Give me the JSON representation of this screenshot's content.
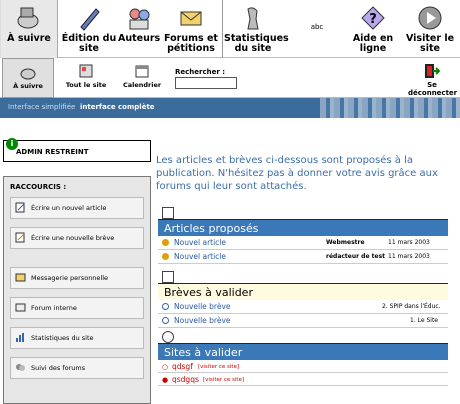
{
  "topnav": [
    {
      "label": "À suivre",
      "icon": "bowl-icon"
    },
    {
      "label": "Édition du site",
      "icon": "pen-icon"
    },
    {
      "label": "Auteurs",
      "icon": "authors-icon"
    },
    {
      "label": "Forums et pétitions",
      "icon": "envelope-icon"
    },
    {
      "label": "Statistiques du site",
      "icon": "sculpture-icon"
    },
    {
      "label": "abc",
      "icon": "language-icon"
    },
    {
      "label": "Aide en ligne",
      "icon": "help-icon"
    },
    {
      "label": "Visiter le site",
      "icon": "play-icon"
    }
  ],
  "subnav": [
    {
      "label": "À suivre"
    },
    {
      "label": "Tout le site"
    },
    {
      "label": "Calendrier"
    }
  ],
  "search": {
    "label": "Rechercher :",
    "value": ""
  },
  "logout": {
    "label": "Se déconnecter"
  },
  "modebar": {
    "simple": "Interface simplifiée",
    "full": "interface complète"
  },
  "aside": {
    "admin": "ADMIN RESTREINT",
    "shortcuts_title": "RACCOURCIS :",
    "shortcuts": [
      "Écrire un nouvel article",
      "Écrire une nouvelle brève",
      "Messagerie personnelle",
      "Forum interne",
      "Statistiques du site",
      "Suivi des forums"
    ]
  },
  "intro": "Les articles et brèves ci-dessous sont proposés à la publication. N'hésitez pas à donner votre avis grâce aux forums qui leur sont attachés.",
  "articles": {
    "title": "Articles proposés",
    "rows": [
      {
        "title": "Nouvel article",
        "author": "Webmestre",
        "date": "11 mars 2003"
      },
      {
        "title": "Nouvel article",
        "author": "rédacteur de test",
        "date": "11 mars 2003"
      }
    ]
  },
  "breves": {
    "title": "Brèves à valider",
    "rows": [
      {
        "title": "Nouvelle brève",
        "rubrique": "2. SPIP dans l'Éduc."
      },
      {
        "title": "Nouvelle brève",
        "rubrique": "1. Le Site"
      }
    ]
  },
  "sites": {
    "title": "Sites à valider",
    "rows": [
      {
        "title": "qdsgf",
        "link": "[visiter ce site]"
      },
      {
        "title": "qsdgqs",
        "link": "[visiter ce site]"
      }
    ]
  }
}
